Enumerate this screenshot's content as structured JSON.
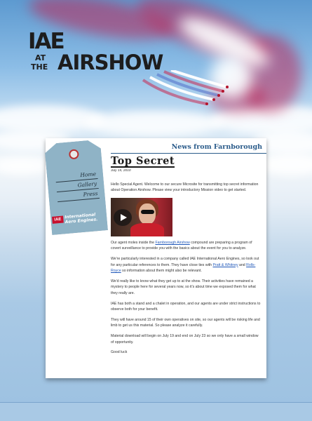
{
  "header": {
    "logo": {
      "line1": "IAE",
      "at": "AT",
      "the": "THE",
      "line2": "AIRSHOW"
    }
  },
  "nav": {
    "items": [
      {
        "label": "Home"
      },
      {
        "label": "Gallery"
      },
      {
        "label": "Press"
      }
    ],
    "brand": {
      "box": "IAE",
      "text": "International Aero Engines."
    }
  },
  "article": {
    "section_title": "News from Farnborough",
    "title": "Top Secret",
    "date": "July 15, 2010",
    "intro": "Hello Special Agent. Welcome to our secure Microsite for transmitting top secret information about Operation Airshow. Please view your introductory Mission video to get started.",
    "p1_before": "Our agent moles inside the ",
    "p1_link": "Farnborough Airshow",
    "p1_after": " compound are preparing a program of covert surveillance to provide you with the basics about the event for you to analyze.",
    "p2_before": "We're particularly interested in a company called IAE International Aero Engines, so look out for any particular references to them. They have close ties with ",
    "p2_link1": "Pratt & Whitney",
    "p2_mid": " and ",
    "p2_link2": "Rolls-Royce",
    "p2_after": " so information about them might also be relevant.",
    "p3": "We'd really like to know what they get up to at the show. Their activities have remained a mystery to people here for several years now, so it's about time we exposed them for what they really are.",
    "p4": "IAE has both a stand and a chalet in operation, and our agents are under strict instructions to observe both for your benefit.",
    "p5": "They will have around 15 of their own operatives on site, so our agents will be risking life and limb to get us this material. So please analyze it carefully.",
    "p6": "Material download will begin on July 19 and end on July 23 so we only have a small window of opportunity.",
    "p7": "Good luck"
  },
  "colors": {
    "link": "#1f57b9",
    "header_blue": "#2a5b8a",
    "tag": "#8fb3c6",
    "brand_red": "#c8102e"
  }
}
